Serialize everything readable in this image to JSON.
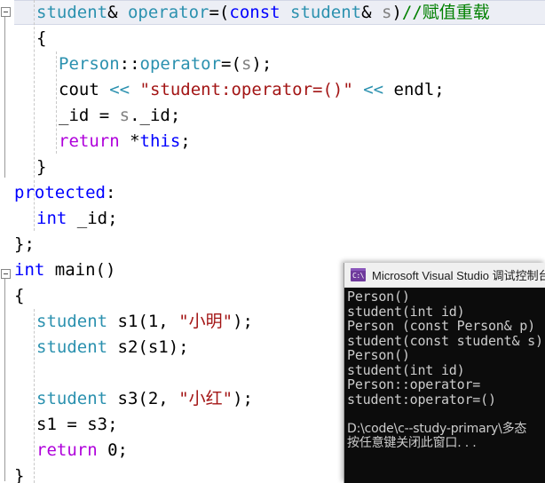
{
  "editor": {
    "name": "visual-studio-code-editor",
    "language": "cpp",
    "current_line_index": 0,
    "code_lines": [
      {
        "indent": 1,
        "tokens": [
          {
            "text": "student",
            "cls": "t-type"
          },
          {
            "text": "& ",
            "cls": "t-plain"
          },
          {
            "text": "operator",
            "cls": "t-type"
          },
          {
            "text": "=(",
            "cls": "t-plain"
          },
          {
            "text": "const",
            "cls": "t-kw"
          },
          {
            "text": " ",
            "cls": "t-plain"
          },
          {
            "text": "student",
            "cls": "t-type"
          },
          {
            "text": "& ",
            "cls": "t-plain"
          },
          {
            "text": "s",
            "cls": "t-param"
          },
          {
            "text": ")",
            "cls": "t-plain"
          },
          {
            "text": "//赋值重载",
            "cls": "t-comment"
          }
        ]
      },
      {
        "indent": 1,
        "tokens": [
          {
            "text": "{",
            "cls": "t-plain"
          }
        ]
      },
      {
        "indent": 2,
        "tokens": [
          {
            "text": "Person",
            "cls": "t-type"
          },
          {
            "text": "::",
            "cls": "t-plain"
          },
          {
            "text": "operator",
            "cls": "t-type"
          },
          {
            "text": "=(",
            "cls": "t-plain"
          },
          {
            "text": "s",
            "cls": "t-param"
          },
          {
            "text": ");",
            "cls": "t-plain"
          }
        ]
      },
      {
        "indent": 2,
        "tokens": [
          {
            "text": "cout ",
            "cls": "t-plain"
          },
          {
            "text": "<<",
            "cls": "t-type"
          },
          {
            "text": " ",
            "cls": "t-plain"
          },
          {
            "text": "\"student:operator=()\"",
            "cls": "t-str"
          },
          {
            "text": " ",
            "cls": "t-plain"
          },
          {
            "text": "<<",
            "cls": "t-type"
          },
          {
            "text": " endl;",
            "cls": "t-plain"
          }
        ]
      },
      {
        "indent": 2,
        "tokens": [
          {
            "text": "_id = ",
            "cls": "t-plain"
          },
          {
            "text": "s",
            "cls": "t-param"
          },
          {
            "text": "._id;",
            "cls": "t-plain"
          }
        ]
      },
      {
        "indent": 2,
        "tokens": [
          {
            "text": "return",
            "cls": "t-ctrl"
          },
          {
            "text": " *",
            "cls": "t-plain"
          },
          {
            "text": "this",
            "cls": "t-kw"
          },
          {
            "text": ";",
            "cls": "t-plain"
          }
        ]
      },
      {
        "indent": 1,
        "tokens": [
          {
            "text": "}",
            "cls": "t-plain"
          }
        ]
      },
      {
        "indent": 0,
        "tokens": [
          {
            "text": "protected",
            "cls": "t-kw"
          },
          {
            "text": ":",
            "cls": "t-plain"
          }
        ]
      },
      {
        "indent": 1,
        "tokens": [
          {
            "text": "int",
            "cls": "t-kw"
          },
          {
            "text": " _id;",
            "cls": "t-plain"
          }
        ]
      },
      {
        "indent": 0,
        "tokens": [
          {
            "text": "};",
            "cls": "t-plain"
          }
        ]
      },
      {
        "indent": 0,
        "tokens": [
          {
            "text": "int",
            "cls": "t-kw"
          },
          {
            "text": " ",
            "cls": "t-plain"
          },
          {
            "text": "main",
            "cls": "t-plain"
          },
          {
            "text": "()",
            "cls": "t-plain"
          }
        ]
      },
      {
        "indent": 0,
        "tokens": [
          {
            "text": "{",
            "cls": "t-plain"
          }
        ]
      },
      {
        "indent": 1,
        "tokens": [
          {
            "text": "student",
            "cls": "t-type"
          },
          {
            "text": " s1(",
            "cls": "t-plain"
          },
          {
            "text": "1",
            "cls": "t-num"
          },
          {
            "text": ", ",
            "cls": "t-plain"
          },
          {
            "text": "\"小明\"",
            "cls": "t-str"
          },
          {
            "text": ");",
            "cls": "t-plain"
          }
        ]
      },
      {
        "indent": 1,
        "tokens": [
          {
            "text": "student",
            "cls": "t-type"
          },
          {
            "text": " s2(s1);",
            "cls": "t-plain"
          }
        ]
      },
      {
        "indent": 1,
        "tokens": []
      },
      {
        "indent": 1,
        "tokens": [
          {
            "text": "student",
            "cls": "t-type"
          },
          {
            "text": " s3(",
            "cls": "t-plain"
          },
          {
            "text": "2",
            "cls": "t-num"
          },
          {
            "text": ", ",
            "cls": "t-plain"
          },
          {
            "text": "\"小红\"",
            "cls": "t-str"
          },
          {
            "text": ");",
            "cls": "t-plain"
          }
        ]
      },
      {
        "indent": 1,
        "tokens": [
          {
            "text": "s1 = s3;",
            "cls": "t-plain"
          }
        ]
      },
      {
        "indent": 1,
        "tokens": [
          {
            "text": "return",
            "cls": "t-ctrl"
          },
          {
            "text": " ",
            "cls": "t-plain"
          },
          {
            "text": "0",
            "cls": "t-num"
          },
          {
            "text": ";",
            "cls": "t-plain"
          }
        ]
      },
      {
        "indent": 0,
        "tokens": [
          {
            "text": "}",
            "cls": "t-plain"
          }
        ]
      }
    ],
    "colors": {
      "background": "#ffffff",
      "type": "#2b91af",
      "keyword": "#0000ff",
      "control": "#af00db",
      "string": "#a31515",
      "comment": "#008000",
      "parameter": "#808080",
      "plain": "#000000",
      "current_line_highlight": "#eceef5"
    }
  },
  "console": {
    "icon": "console-app-icon",
    "icon_glyph": "C:\\",
    "title": "Microsoft Visual Studio 调试控制台",
    "background": "#0c0c0c",
    "text_color": "#cccccc",
    "output_lines": [
      "Person()",
      "student(int id)",
      "Person (const Person& p)",
      "student(const student& s)",
      "Person()",
      "student(int id)",
      "Person::operator=",
      "student:operator=()",
      "",
      "D:\\code\\c--study-primary\\多态",
      "按任意键关闭此窗口. . ."
    ]
  }
}
